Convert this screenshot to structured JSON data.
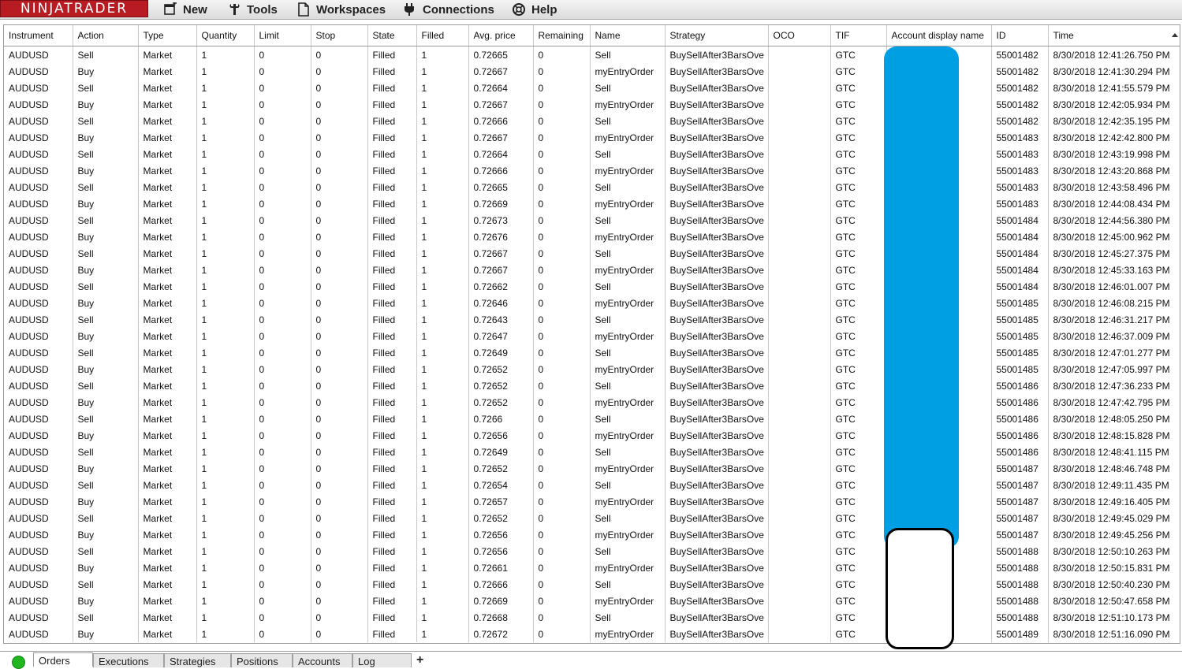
{
  "app": {
    "logo_text": "NINJATRADER",
    "menu": [
      {
        "label": "New",
        "icon": "new-window-icon"
      },
      {
        "label": "Tools",
        "icon": "wrench-icon"
      },
      {
        "label": "Workspaces",
        "icon": "document-icon"
      },
      {
        "label": "Connections",
        "icon": "plug-icon"
      },
      {
        "label": "Help",
        "icon": "help-lifebuoy-icon"
      }
    ]
  },
  "grid": {
    "columns": [
      "Instrument",
      "Action",
      "Type",
      "Quantity",
      "Limit",
      "Stop",
      "State",
      "Filled",
      "Avg. price",
      "Remaining",
      "Name",
      "Strategy",
      "OCO",
      "TIF",
      "Account display name",
      "ID",
      "Time"
    ],
    "sort_column": "Time",
    "rows": [
      [
        "AUDUSD",
        "Sell",
        "Market",
        "1",
        "0",
        "0",
        "Filled",
        "1",
        "0.72665",
        "0",
        "Sell",
        "BuySellAfter3BarsOve",
        "",
        "GTC",
        "",
        "55001482",
        "8/30/2018 12:41:26.750 PM"
      ],
      [
        "AUDUSD",
        "Buy",
        "Market",
        "1",
        "0",
        "0",
        "Filled",
        "1",
        "0.72667",
        "0",
        "myEntryOrder",
        "BuySellAfter3BarsOve",
        "",
        "GTC",
        "",
        "55001482",
        "8/30/2018 12:41:30.294 PM"
      ],
      [
        "AUDUSD",
        "Sell",
        "Market",
        "1",
        "0",
        "0",
        "Filled",
        "1",
        "0.72664",
        "0",
        "Sell",
        "BuySellAfter3BarsOve",
        "",
        "GTC",
        "",
        "55001482",
        "8/30/2018 12:41:55.579 PM"
      ],
      [
        "AUDUSD",
        "Buy",
        "Market",
        "1",
        "0",
        "0",
        "Filled",
        "1",
        "0.72667",
        "0",
        "myEntryOrder",
        "BuySellAfter3BarsOve",
        "",
        "GTC",
        "",
        "55001482",
        "8/30/2018 12:42:05.934 PM"
      ],
      [
        "AUDUSD",
        "Sell",
        "Market",
        "1",
        "0",
        "0",
        "Filled",
        "1",
        "0.72666",
        "0",
        "Sell",
        "BuySellAfter3BarsOve",
        "",
        "GTC",
        "",
        "55001482",
        "8/30/2018 12:42:35.195 PM"
      ],
      [
        "AUDUSD",
        "Buy",
        "Market",
        "1",
        "0",
        "0",
        "Filled",
        "1",
        "0.72667",
        "0",
        "myEntryOrder",
        "BuySellAfter3BarsOve",
        "",
        "GTC",
        "",
        "55001483",
        "8/30/2018 12:42:42.800 PM"
      ],
      [
        "AUDUSD",
        "Sell",
        "Market",
        "1",
        "0",
        "0",
        "Filled",
        "1",
        "0.72664",
        "0",
        "Sell",
        "BuySellAfter3BarsOve",
        "",
        "GTC",
        "",
        "55001483",
        "8/30/2018 12:43:19.998 PM"
      ],
      [
        "AUDUSD",
        "Buy",
        "Market",
        "1",
        "0",
        "0",
        "Filled",
        "1",
        "0.72666",
        "0",
        "myEntryOrder",
        "BuySellAfter3BarsOve",
        "",
        "GTC",
        "",
        "55001483",
        "8/30/2018 12:43:20.868 PM"
      ],
      [
        "AUDUSD",
        "Sell",
        "Market",
        "1",
        "0",
        "0",
        "Filled",
        "1",
        "0.72665",
        "0",
        "Sell",
        "BuySellAfter3BarsOve",
        "",
        "GTC",
        "",
        "55001483",
        "8/30/2018 12:43:58.496 PM"
      ],
      [
        "AUDUSD",
        "Buy",
        "Market",
        "1",
        "0",
        "0",
        "Filled",
        "1",
        "0.72669",
        "0",
        "myEntryOrder",
        "BuySellAfter3BarsOve",
        "",
        "GTC",
        "",
        "55001483",
        "8/30/2018 12:44:08.434 PM"
      ],
      [
        "AUDUSD",
        "Sell",
        "Market",
        "1",
        "0",
        "0",
        "Filled",
        "1",
        "0.72673",
        "0",
        "Sell",
        "BuySellAfter3BarsOve",
        "",
        "GTC",
        "",
        "55001484",
        "8/30/2018 12:44:56.380 PM"
      ],
      [
        "AUDUSD",
        "Buy",
        "Market",
        "1",
        "0",
        "0",
        "Filled",
        "1",
        "0.72676",
        "0",
        "myEntryOrder",
        "BuySellAfter3BarsOve",
        "",
        "GTC",
        "",
        "55001484",
        "8/30/2018 12:45:00.962 PM"
      ],
      [
        "AUDUSD",
        "Sell",
        "Market",
        "1",
        "0",
        "0",
        "Filled",
        "1",
        "0.72667",
        "0",
        "Sell",
        "BuySellAfter3BarsOve",
        "",
        "GTC",
        "",
        "55001484",
        "8/30/2018 12:45:27.375 PM"
      ],
      [
        "AUDUSD",
        "Buy",
        "Market",
        "1",
        "0",
        "0",
        "Filled",
        "1",
        "0.72667",
        "0",
        "myEntryOrder",
        "BuySellAfter3BarsOve",
        "",
        "GTC",
        "",
        "55001484",
        "8/30/2018 12:45:33.163 PM"
      ],
      [
        "AUDUSD",
        "Sell",
        "Market",
        "1",
        "0",
        "0",
        "Filled",
        "1",
        "0.72662",
        "0",
        "Sell",
        "BuySellAfter3BarsOve",
        "",
        "GTC",
        "",
        "55001484",
        "8/30/2018 12:46:01.007 PM"
      ],
      [
        "AUDUSD",
        "Buy",
        "Market",
        "1",
        "0",
        "0",
        "Filled",
        "1",
        "0.72646",
        "0",
        "myEntryOrder",
        "BuySellAfter3BarsOve",
        "",
        "GTC",
        "",
        "55001485",
        "8/30/2018 12:46:08.215 PM"
      ],
      [
        "AUDUSD",
        "Sell",
        "Market",
        "1",
        "0",
        "0",
        "Filled",
        "1",
        "0.72643",
        "0",
        "Sell",
        "BuySellAfter3BarsOve",
        "",
        "GTC",
        "",
        "55001485",
        "8/30/2018 12:46:31.217 PM"
      ],
      [
        "AUDUSD",
        "Buy",
        "Market",
        "1",
        "0",
        "0",
        "Filled",
        "1",
        "0.72647",
        "0",
        "myEntryOrder",
        "BuySellAfter3BarsOve",
        "",
        "GTC",
        "",
        "55001485",
        "8/30/2018 12:46:37.009 PM"
      ],
      [
        "AUDUSD",
        "Sell",
        "Market",
        "1",
        "0",
        "0",
        "Filled",
        "1",
        "0.72649",
        "0",
        "Sell",
        "BuySellAfter3BarsOve",
        "",
        "GTC",
        "",
        "55001485",
        "8/30/2018 12:47:01.277 PM"
      ],
      [
        "AUDUSD",
        "Buy",
        "Market",
        "1",
        "0",
        "0",
        "Filled",
        "1",
        "0.72652",
        "0",
        "myEntryOrder",
        "BuySellAfter3BarsOve",
        "",
        "GTC",
        "",
        "55001485",
        "8/30/2018 12:47:05.997 PM"
      ],
      [
        "AUDUSD",
        "Sell",
        "Market",
        "1",
        "0",
        "0",
        "Filled",
        "1",
        "0.72652",
        "0",
        "Sell",
        "BuySellAfter3BarsOve",
        "",
        "GTC",
        "",
        "55001486",
        "8/30/2018 12:47:36.233 PM"
      ],
      [
        "AUDUSD",
        "Buy",
        "Market",
        "1",
        "0",
        "0",
        "Filled",
        "1",
        "0.72652",
        "0",
        "myEntryOrder",
        "BuySellAfter3BarsOve",
        "",
        "GTC",
        "",
        "55001486",
        "8/30/2018 12:47:42.795 PM"
      ],
      [
        "AUDUSD",
        "Sell",
        "Market",
        "1",
        "0",
        "0",
        "Filled",
        "1",
        "0.7266",
        "0",
        "Sell",
        "BuySellAfter3BarsOve",
        "",
        "GTC",
        "",
        "55001486",
        "8/30/2018 12:48:05.250 PM"
      ],
      [
        "AUDUSD",
        "Buy",
        "Market",
        "1",
        "0",
        "0",
        "Filled",
        "1",
        "0.72656",
        "0",
        "myEntryOrder",
        "BuySellAfter3BarsOve",
        "",
        "GTC",
        "",
        "55001486",
        "8/30/2018 12:48:15.828 PM"
      ],
      [
        "AUDUSD",
        "Sell",
        "Market",
        "1",
        "0",
        "0",
        "Filled",
        "1",
        "0.72649",
        "0",
        "Sell",
        "BuySellAfter3BarsOve",
        "",
        "GTC",
        "",
        "55001486",
        "8/30/2018 12:48:41.115 PM"
      ],
      [
        "AUDUSD",
        "Buy",
        "Market",
        "1",
        "0",
        "0",
        "Filled",
        "1",
        "0.72652",
        "0",
        "myEntryOrder",
        "BuySellAfter3BarsOve",
        "",
        "GTC",
        "",
        "55001487",
        "8/30/2018 12:48:46.748 PM"
      ],
      [
        "AUDUSD",
        "Sell",
        "Market",
        "1",
        "0",
        "0",
        "Filled",
        "1",
        "0.72654",
        "0",
        "Sell",
        "BuySellAfter3BarsOve",
        "",
        "GTC",
        "",
        "55001487",
        "8/30/2018 12:49:11.435 PM"
      ],
      [
        "AUDUSD",
        "Buy",
        "Market",
        "1",
        "0",
        "0",
        "Filled",
        "1",
        "0.72657",
        "0",
        "myEntryOrder",
        "BuySellAfter3BarsOve",
        "",
        "GTC",
        "",
        "55001487",
        "8/30/2018 12:49:16.405 PM"
      ],
      [
        "AUDUSD",
        "Sell",
        "Market",
        "1",
        "0",
        "0",
        "Filled",
        "1",
        "0.72652",
        "0",
        "Sell",
        "BuySellAfter3BarsOve",
        "",
        "GTC",
        "",
        "55001487",
        "8/30/2018 12:49:45.029 PM"
      ],
      [
        "AUDUSD",
        "Buy",
        "Market",
        "1",
        "0",
        "0",
        "Filled",
        "1",
        "0.72656",
        "0",
        "myEntryOrder",
        "BuySellAfter3BarsOve",
        "",
        "GTC",
        "",
        "55001487",
        "8/30/2018 12:49:45.256 PM"
      ],
      [
        "AUDUSD",
        "Sell",
        "Market",
        "1",
        "0",
        "0",
        "Filled",
        "1",
        "0.72656",
        "0",
        "Sell",
        "BuySellAfter3BarsOve",
        "",
        "GTC",
        "",
        "55001488",
        "8/30/2018 12:50:10.263 PM"
      ],
      [
        "AUDUSD",
        "Buy",
        "Market",
        "1",
        "0",
        "0",
        "Filled",
        "1",
        "0.72661",
        "0",
        "myEntryOrder",
        "BuySellAfter3BarsOve",
        "",
        "GTC",
        "",
        "55001488",
        "8/30/2018 12:50:15.831 PM"
      ],
      [
        "AUDUSD",
        "Sell",
        "Market",
        "1",
        "0",
        "0",
        "Filled",
        "1",
        "0.72666",
        "0",
        "Sell",
        "BuySellAfter3BarsOve",
        "",
        "GTC",
        "",
        "55001488",
        "8/30/2018 12:50:40.230 PM"
      ],
      [
        "AUDUSD",
        "Buy",
        "Market",
        "1",
        "0",
        "0",
        "Filled",
        "1",
        "0.72669",
        "0",
        "myEntryOrder",
        "BuySellAfter3BarsOve",
        "",
        "GTC",
        "",
        "55001488",
        "8/30/2018 12:50:47.658 PM"
      ],
      [
        "AUDUSD",
        "Sell",
        "Market",
        "1",
        "0",
        "0",
        "Filled",
        "1",
        "0.72668",
        "0",
        "Sell",
        "BuySellAfter3BarsOve",
        "",
        "GTC",
        "",
        "55001488",
        "8/30/2018 12:51:10.173 PM"
      ],
      [
        "AUDUSD",
        "Buy",
        "Market",
        "1",
        "0",
        "0",
        "Filled",
        "1",
        "0.72672",
        "0",
        "myEntryOrder",
        "BuySellAfter3BarsOve",
        "",
        "GTC",
        "",
        "55001489",
        "8/30/2018 12:51:16.090 PM"
      ]
    ]
  },
  "tabs": {
    "items": [
      "Orders",
      "Executions",
      "Strategies",
      "Positions",
      "Accounts",
      "Log"
    ],
    "active": "Orders",
    "add_label": "+",
    "connection_status_color": "#22b522"
  },
  "colors": {
    "logo_bg": "#b81c22",
    "redaction_blue": "#009ee3"
  }
}
